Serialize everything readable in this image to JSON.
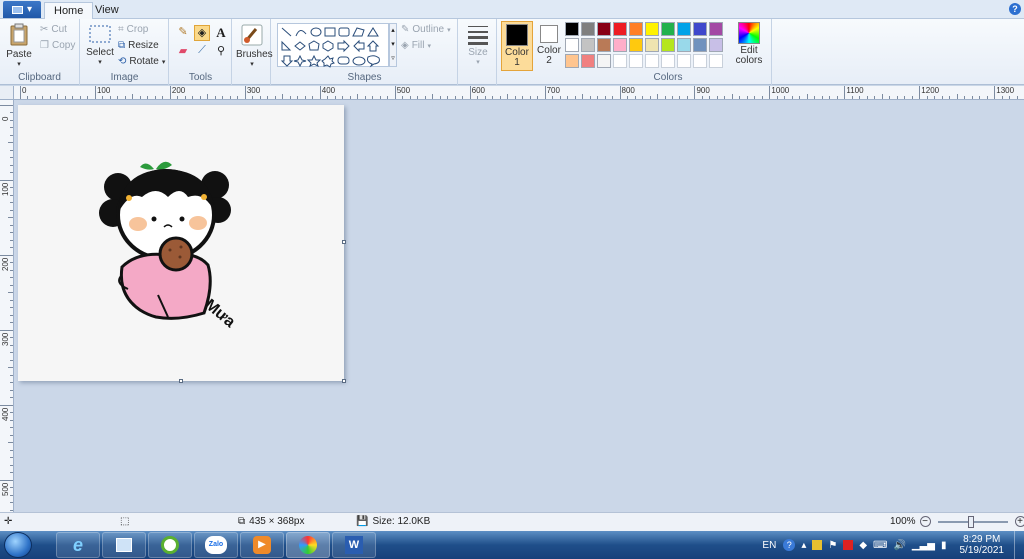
{
  "tabs": {
    "home": "Home",
    "view": "View"
  },
  "clipboard": {
    "paste": "Paste",
    "cut": "Cut",
    "copy": "Copy",
    "label": "Clipboard"
  },
  "image": {
    "select": "Select",
    "crop": "Crop",
    "resize": "Resize",
    "rotate": "Rotate",
    "label": "Image"
  },
  "tools": {
    "label": "Tools"
  },
  "brushes": {
    "label": "Brushes"
  },
  "shapes": {
    "outline": "Outline",
    "fill": "Fill",
    "label": "Shapes"
  },
  "size": {
    "label": "Size"
  },
  "color1": {
    "line1": "Color",
    "line2": "1"
  },
  "color2": {
    "line1": "Color",
    "line2": "2"
  },
  "colors": {
    "label": "Colors",
    "edit_line1": "Edit",
    "edit_line2": "colors",
    "color1_value": "#000000",
    "color2_value": "#ffffff",
    "row1": [
      "#000000",
      "#7f7f7f",
      "#880015",
      "#ed1c24",
      "#ff7f27",
      "#fff200",
      "#22b14c",
      "#00a2e8",
      "#3f48cc",
      "#a349a4"
    ],
    "row2": [
      "#ffffff",
      "#c3c3c3",
      "#b97a57",
      "#ffaec9",
      "#ffc90e",
      "#efe4b0",
      "#b5e61d",
      "#99d9ea",
      "#7092be",
      "#c8bfe7"
    ],
    "row3": [
      "#ffc58f",
      "#f08080",
      "#f5f5f5",
      "",
      "",
      "",
      "",
      "",
      "",
      ""
    ]
  },
  "ruler_h": [
    "0",
    "100",
    "200",
    "300",
    "400",
    "500",
    "600",
    "700",
    "800",
    "900",
    "1000",
    "1100",
    "1200",
    "1300"
  ],
  "ruler_v": [
    "0",
    "100",
    "200",
    "300",
    "400",
    "500"
  ],
  "status": {
    "dimensions": "435 × 368px",
    "filesize": "Size: 12.0KB",
    "zoom": "100%"
  },
  "drawing": {
    "signature": "Mưa"
  },
  "taskbar": {
    "lang": "EN",
    "time": "8:29 PM",
    "date": "5/19/2021",
    "zalo": "Zalo"
  }
}
